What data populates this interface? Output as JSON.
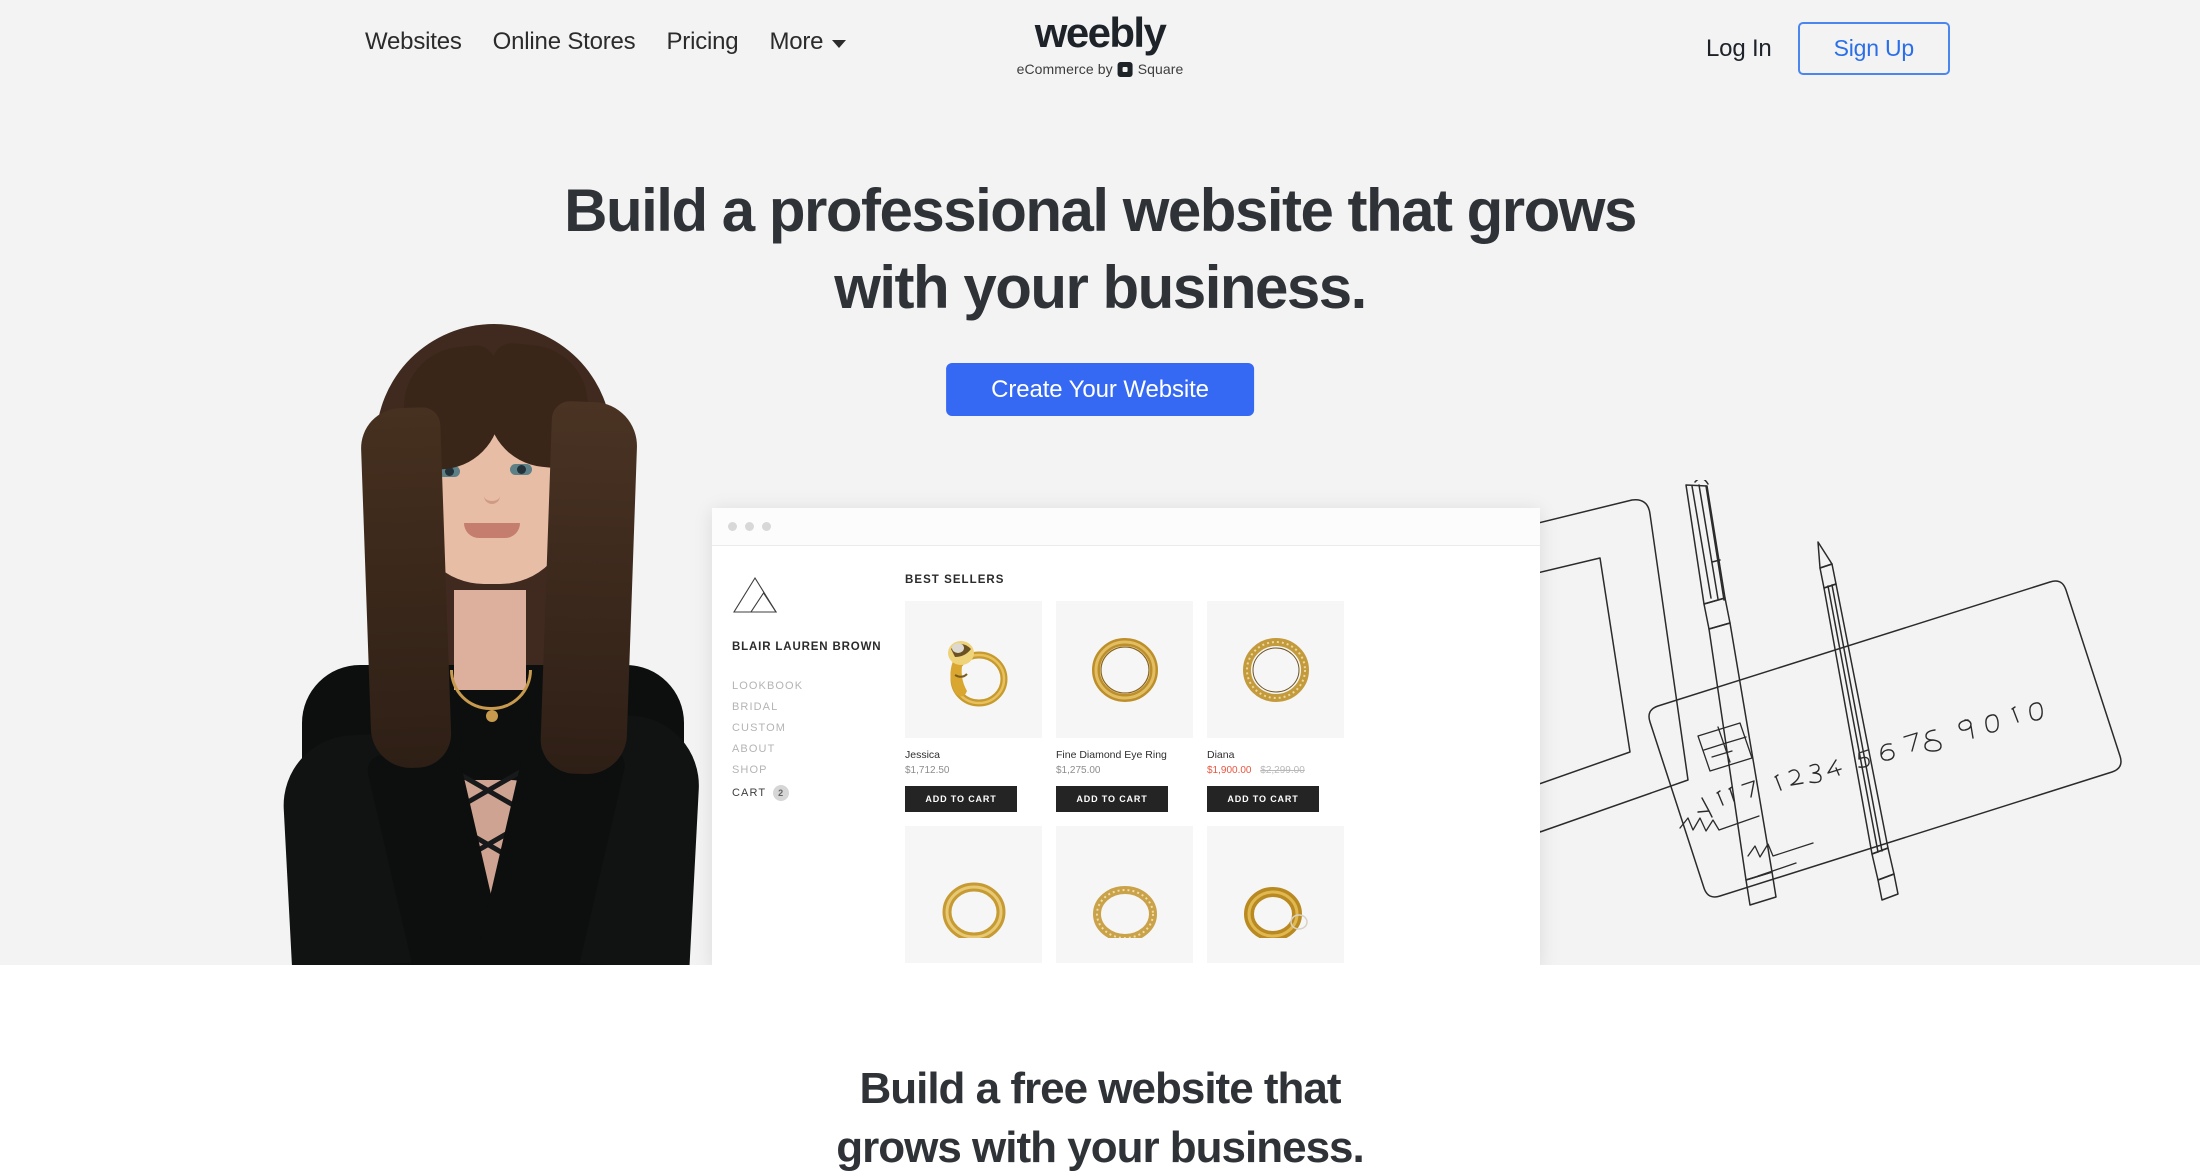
{
  "nav": {
    "links": [
      {
        "label": "Websites"
      },
      {
        "label": "Online Stores"
      },
      {
        "label": "Pricing"
      },
      {
        "label": "More"
      }
    ],
    "login_label": "Log In",
    "signup_label": "Sign Up",
    "signup_border_color": "#4a86ee",
    "signup_text_color": "#2b6fe8"
  },
  "logo": {
    "wordmark": "weebly",
    "tagline_prefix": "eCommerce by",
    "tagline_brand": "Square"
  },
  "hero": {
    "headline_line1": "Build a professional website that grows",
    "headline_line2": "with your business.",
    "cta_label": "Create Your Website",
    "cta_color": "#3569f3",
    "background_color": "#f3f3f3"
  },
  "mockup": {
    "store": {
      "brand_name": "BLAIR LAUREN BROWN",
      "nav": [
        {
          "label": "LOOKBOOK",
          "active": false
        },
        {
          "label": "BRIDAL",
          "active": false
        },
        {
          "label": "CUSTOM",
          "active": false
        },
        {
          "label": "ABOUT",
          "active": false
        },
        {
          "label": "SHOP",
          "active": false
        },
        {
          "label": "CART",
          "active": true,
          "badge": "2"
        }
      ],
      "section_label": "BEST SELLERS",
      "add_to_cart_label": "ADD TO CART",
      "products": [
        {
          "name": "Jessica",
          "price": "$1,712.50",
          "sale_price": "",
          "old_price": ""
        },
        {
          "name": "Fine Diamond Eye Ring",
          "price": "$1,275.00",
          "sale_price": "",
          "old_price": ""
        },
        {
          "name": "Diana",
          "price": "",
          "sale_price": "$1,900.00",
          "old_price": "$2,299.00"
        }
      ],
      "sale_price_color": "#e8563f"
    }
  },
  "sketch": {
    "card_number": "4417 1234 5678 9010"
  },
  "below": {
    "headline_line1": "Build a free website that",
    "headline_line2": "grows with your business."
  }
}
